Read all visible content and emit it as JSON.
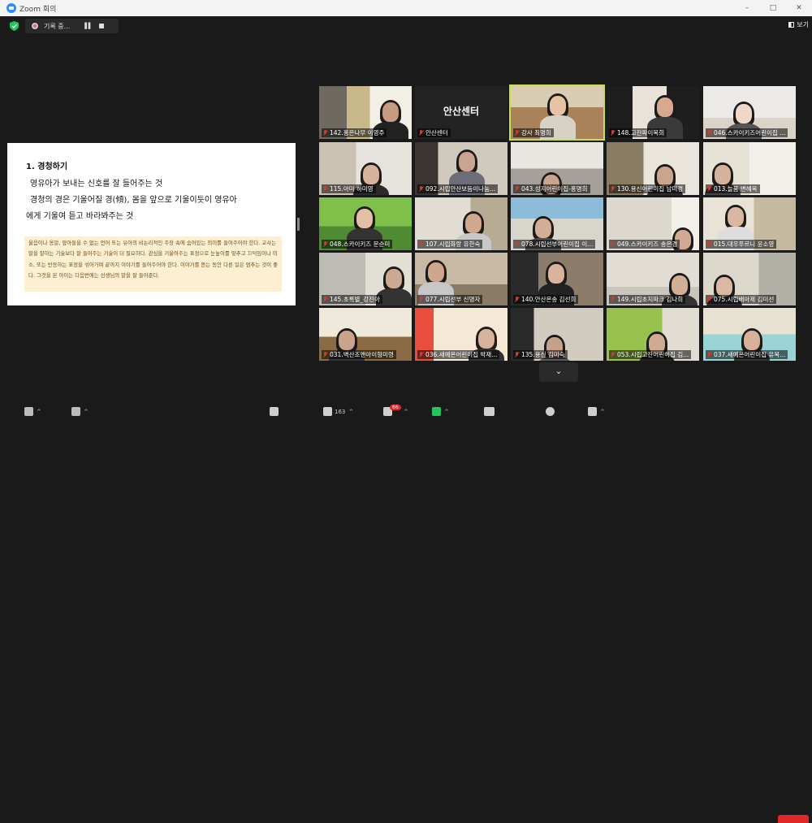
{
  "titlebar": {
    "title": "Zoom 회의",
    "controls": [
      "–",
      "□",
      "✕"
    ]
  },
  "recording": {
    "status": "기록 중...",
    "pause_icon": "pause-icon",
    "stop_icon": "stop-icon"
  },
  "view": {
    "label": "보기"
  },
  "share": {
    "heading": "1.  경청하기",
    "lines": [
      "영유아가 보내는 신호를 잘 들어주는 것",
      "경청의 경은 기울어질 경(傾), 몸을 앞으로 기울이듯이 영유아",
      "에게 기울여 듣고 바라봐주는 것"
    ],
    "note": "울음이나 옹알, 앞아들을 수 없는 언어 또는 유아의 비논리적인 주장 속에 숨어있는 의미를 들여주어야 한다. 교사는 말을 잘하는 기술보다 잘 들어주는 기술이 더 필요하다. 관심을 기울여주는 표정으로 눈높이를 맞추고 끄덕임이나 미소, 또는 반응하는 표정을 섞어가며 끝까지 이야기를 들어주어야 한다. 이야기를 듣는 동안 다른 일은 멈추는 것이 좋다. 그것을 본 아이는 다음번에는 선생님의 말을 잘 들어준다."
  },
  "participants": [
    {
      "name": "142.홍은나무 이영주"
    },
    {
      "name": "안산센터",
      "label": "안산센터"
    },
    {
      "name": "강사 최명희"
    },
    {
      "name": "148.고잔파이복희"
    },
    {
      "name": "046.스카이키즈어린이집 ..."
    },
    {
      "name": "115.아미 하미영"
    },
    {
      "name": "092.시립안산보듬이나눔..."
    },
    {
      "name": "043.성지어린이집-홍명희"
    },
    {
      "name": "130.용신어린이집 남미경"
    },
    {
      "name": "013.늘품 변혜옥"
    },
    {
      "name": "048.스카이키즈 문순미"
    },
    {
      "name": "107.시립화랑 유한숙"
    },
    {
      "name": "078.시립선부어린이집 이..."
    },
    {
      "name": "049.스카이키즈 송은경"
    },
    {
      "name": "015.대우푸르니 윤소영"
    },
    {
      "name": "145.초록별_강진아"
    },
    {
      "name": "077.시립선부 신명자"
    },
    {
      "name": "140.안산온송 김선희"
    },
    {
      "name": "149.시립초지파크 김나희"
    },
    {
      "name": "075.시립배아제 김미선"
    },
    {
      "name": "031.벽산조앤아이형미령"
    },
    {
      "name": "036.새예온어린이집 박재..."
    },
    {
      "name": "135.용신 김미숙"
    },
    {
      "name": "053.시립고잔어린이집 김..."
    },
    {
      "name": "037.새예온어린이집 유복..."
    }
  ],
  "toolbar": {
    "participants_count": "163",
    "chat_badge": "66",
    "items": [
      "mic-icon",
      "video-icon",
      "security-icon",
      "participants-icon",
      "chat-icon",
      "share-screen-icon",
      "record-icon",
      "reactions-icon",
      "apps-icon",
      "more-icon",
      "leave-button"
    ]
  }
}
